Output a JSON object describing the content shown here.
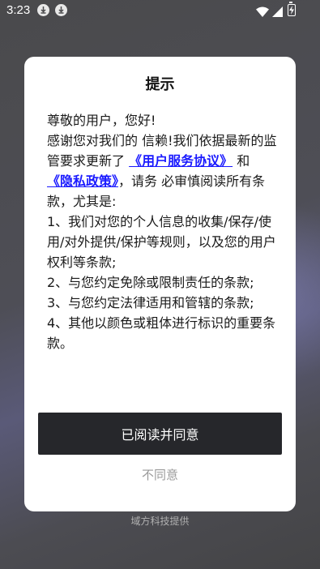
{
  "status_bar": {
    "time": "3:23",
    "icons": [
      "download-icon",
      "download-icon",
      "wifi-icon",
      "signal-icon",
      "battery-charging-icon"
    ]
  },
  "dialog": {
    "title": "提示",
    "greeting": "尊敬的用户，您好!",
    "intro_before": "感谢您对我们的 信赖!我们依据最新的监管要求更新了 ",
    "link_agreement": "《用户服务协议》",
    "and_text": " 和 ",
    "link_privacy": "《隐私政策》",
    "intro_after": "，请务 必审慎阅读所有条款，尤其是:",
    "item1": " 1、我们对您的个人信息的收集/保存/使 用/对外提供/保护等规则，以及您的用户 权利等条款;",
    "item2": " 2、与您约定免除或限制责任的条款;",
    "item3": " 3、与您约定法律适用和管辖的条款;",
    "item4": " 4、其他以颜色或粗体进行标识的重要条 款。",
    "agree_label": "已阅读并同意",
    "disagree_label": "不同意"
  },
  "footer": {
    "text": "域方科技提供"
  },
  "colors": {
    "link": "#1a1aff",
    "button_bg": "#26272b",
    "disagree_text": "#9a9a9a"
  }
}
